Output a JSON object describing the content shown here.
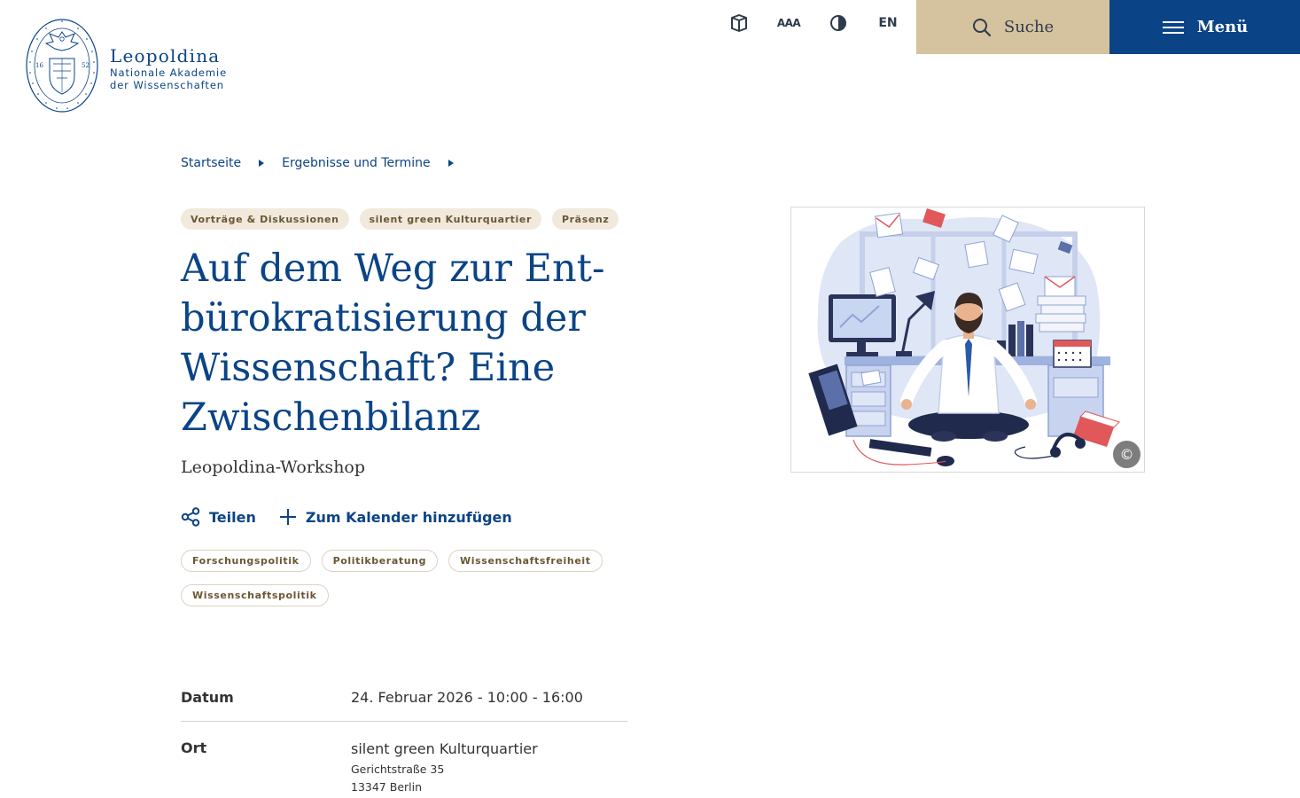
{
  "header": {
    "logo": {
      "name": "Leopoldina",
      "line1": "Nationale Akademie",
      "line2": "der Wissenschaften",
      "seal_ring_text": "CAROLINA NATURAE CURIOSORUM · ACADEMIA CAESAREA LEOPOLDINO",
      "seal_year_left": "16",
      "seal_year_right": "52"
    },
    "tools": {
      "easy_language_icon": "open-book-icon",
      "font_size_label": "AAA",
      "contrast_icon": "contrast-icon",
      "language_label": "EN"
    },
    "search_label": "Suche",
    "menu_label": "Menü"
  },
  "breadcrumb": {
    "items": [
      "Startseite",
      "Ergebnisse und Termine"
    ]
  },
  "event": {
    "category_tags": [
      "Vorträge & Diskussionen",
      "silent green Kulturquartier",
      "Präsenz"
    ],
    "title": "Auf dem Weg zur Ent-bürokratisierung der Wissenschaft? Eine Zwischenbilanz",
    "subtitle": "Leopoldina-Workshop",
    "actions": {
      "share_label": "Teilen",
      "calendar_label": "Zum Kalender hinzufügen"
    },
    "topic_tags": [
      "Forschungspolitik",
      "Politikberatung",
      "Wissenschaftsfreiheit",
      "Wissenschaftspolitik"
    ],
    "details": {
      "date_label": "Datum",
      "date_value": "24. Februar 2026 - 10:00 - 16:00",
      "place_label": "Ort",
      "place_name": "silent green Kulturquartier",
      "place_street": "Gerichtstraße 35",
      "place_city": "13347 Berlin"
    },
    "image": {
      "copyright_symbol": "©"
    }
  },
  "colors": {
    "brand_blue": "#0b4486",
    "search_beige": "#d5c29f",
    "tag_beige": "#f1e9dc",
    "tag_text": "#6b5634"
  }
}
